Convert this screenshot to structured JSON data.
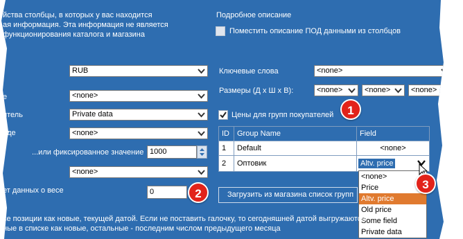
{
  "intro": {
    "line1": "йства столбцы, в которых у вас  находится",
    "line2": "ая информация. Эта информация не является",
    "line3": "функционирования каталога и магазина"
  },
  "detail": {
    "title": "Подробное описание",
    "checkbox_label": "Поместить описание ПОД данными из столбцов"
  },
  "left": {
    "currency_value": "RUB",
    "row2_label": "е",
    "row2_value": "<none>",
    "row3_label": "итель",
    "row3_value": "Private data",
    "row4_label": "аде",
    "row4_value": "<none>",
    "fixed_label": "...или фиксированное значение",
    "fixed_value": "1000",
    "row6_value": "<none>",
    "weight_label": "ет данных о весе",
    "weight_value": "0"
  },
  "right": {
    "keywords_label": "Ключевые слова",
    "keywords_value": "<none>",
    "sizes_label": "Размеры (Д х Ш х В):",
    "size1": "<none>",
    "size2": "<none>",
    "size3": "<none>",
    "group_prices_label": "Цены для групп покупателей"
  },
  "group_table": {
    "headers": [
      "ID",
      "Group Name",
      "Field"
    ],
    "rows": [
      {
        "id": "1",
        "name": "Default",
        "field": "<none>"
      },
      {
        "id": "2",
        "name": "Оптовик",
        "field": "Altv. price"
      }
    ]
  },
  "dropdown": {
    "options": [
      "<none>",
      "Price",
      "Altv. price",
      "Old price",
      "Some field",
      "Private data"
    ],
    "selected": "Altv. price"
  },
  "load_button": "Загрузить из магазина список групп",
  "footer": {
    "line1": "се позиции как новые, текущей датой. Если не поставить галочку, то  сегодняшней датой выгружаются",
    "line2": "ные в списке как новые, остальные - последним числом предыдущего месяца"
  },
  "badges": {
    "b1": "1",
    "b2": "2",
    "b3": "3"
  },
  "colors": {
    "panel": "#2e6db0",
    "badge": "#e2231a",
    "highlight": "#e07a2f"
  }
}
